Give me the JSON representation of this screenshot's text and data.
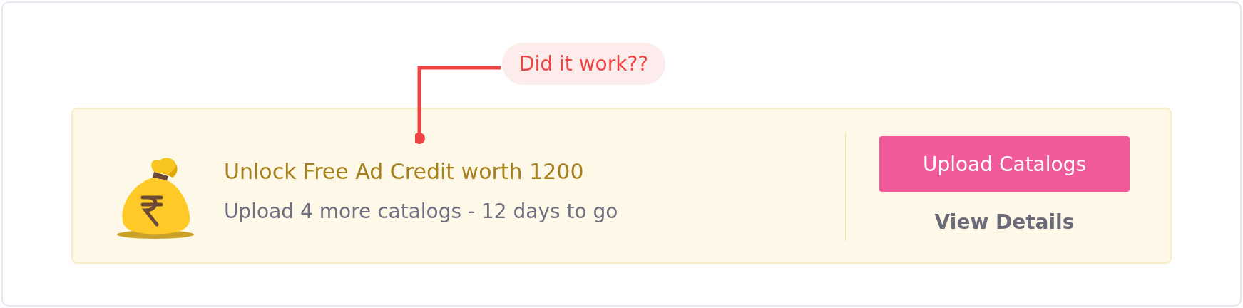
{
  "annotation": {
    "text": "Did it work??"
  },
  "banner": {
    "title": "Unlock Free Ad Credit worth 1200",
    "subtitle": "Upload 4 more catalogs - 12 days to go",
    "primary_button": "Upload Catalogs",
    "link": "View Details"
  }
}
